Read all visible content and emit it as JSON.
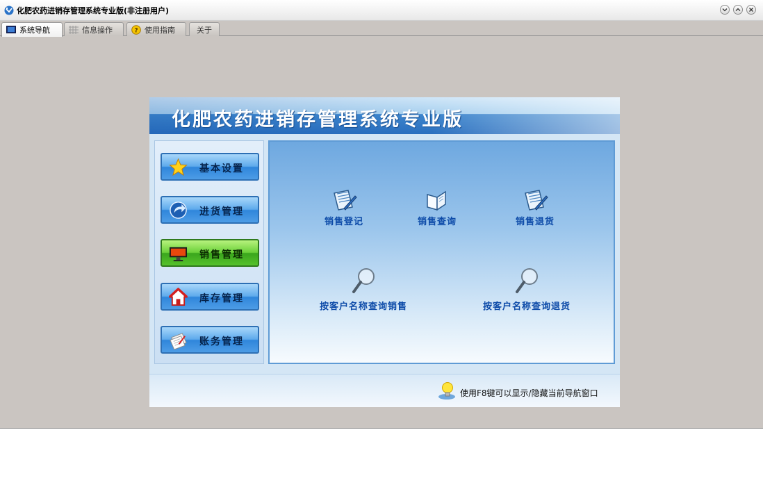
{
  "window": {
    "title": "化肥农药进销存管理系统专业版(非注册用户)",
    "buttons": [
      "minimize",
      "maximize",
      "close"
    ]
  },
  "tabs": [
    {
      "label": "系统导航",
      "icon": "monitor-icon",
      "active": true
    },
    {
      "label": "信息操作",
      "icon": "grid-icon",
      "active": false
    },
    {
      "label": "使用指南",
      "icon": "help-icon",
      "active": false
    },
    {
      "label": "关于",
      "icon": "",
      "active": false
    }
  ],
  "banner": {
    "title": "化肥农药进销存管理系统专业版"
  },
  "sidebar": {
    "items": [
      {
        "label": "基本设置",
        "icon": "star-icon",
        "active": false
      },
      {
        "label": "进货管理",
        "icon": "arrow-icon",
        "active": false
      },
      {
        "label": "销售管理",
        "icon": "monitor-icon",
        "active": true
      },
      {
        "label": "库存管理",
        "icon": "house-icon",
        "active": false
      },
      {
        "label": "账务管理",
        "icon": "notes-icon",
        "active": false
      }
    ]
  },
  "functions": [
    {
      "label": "销售登记",
      "icon": "notebook-pen-icon"
    },
    {
      "label": "销售查询",
      "icon": "book-icon"
    },
    {
      "label": "销售退货",
      "icon": "notebook-pen-icon"
    },
    {
      "label": "按客户名称查询销售",
      "icon": "magnifier-icon"
    },
    {
      "label": "按客户名称查询退货",
      "icon": "magnifier-icon"
    }
  ],
  "footer": {
    "hint": "使用F8键可以显示/隐藏当前导航窗口",
    "icon": "lightbulb-icon"
  },
  "colors": {
    "accent": "#2f86db",
    "active": "#3aa61c",
    "link": "#0c4aa8",
    "background": "#cac5c1"
  }
}
